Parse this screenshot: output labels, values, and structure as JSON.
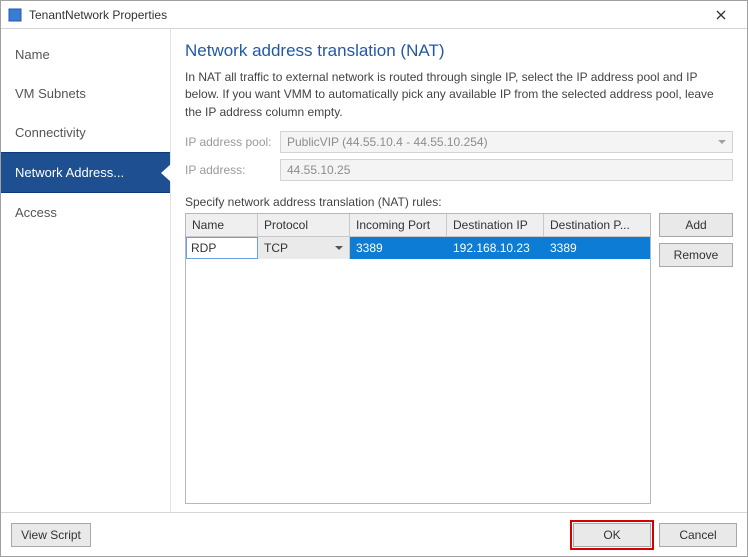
{
  "window": {
    "title": "TenantNetwork Properties"
  },
  "sidebar": {
    "items": [
      {
        "label": "Name"
      },
      {
        "label": "VM Subnets"
      },
      {
        "label": "Connectivity"
      },
      {
        "label": "Network Address..."
      },
      {
        "label": "Access"
      }
    ],
    "selected_index": 3
  },
  "main": {
    "title": "Network address translation (NAT)",
    "description": "In NAT all traffic to external network is routed through single IP, select the IP address pool and IP below. If you want VMM to automatically pick any available IP from the selected address pool, leave the IP address column empty.",
    "pool_label": "IP address pool:",
    "pool_value": "PublicVIP (44.55.10.4 - 44.55.10.254)",
    "ip_label": "IP address:",
    "ip_value": "44.55.10.25",
    "rules_label": "Specify network address translation (NAT) rules:",
    "columns": {
      "name": "Name",
      "protocol": "Protocol",
      "incoming": "Incoming Port",
      "destip": "Destination IP",
      "destport": "Destination P..."
    },
    "rows": [
      {
        "name": "RDP",
        "protocol": "TCP",
        "incoming": "3389",
        "destip": "192.168.10.23",
        "destport": "3389"
      }
    ],
    "add_label": "Add",
    "remove_label": "Remove"
  },
  "footer": {
    "view_script": "View Script",
    "ok": "OK",
    "cancel": "Cancel"
  }
}
